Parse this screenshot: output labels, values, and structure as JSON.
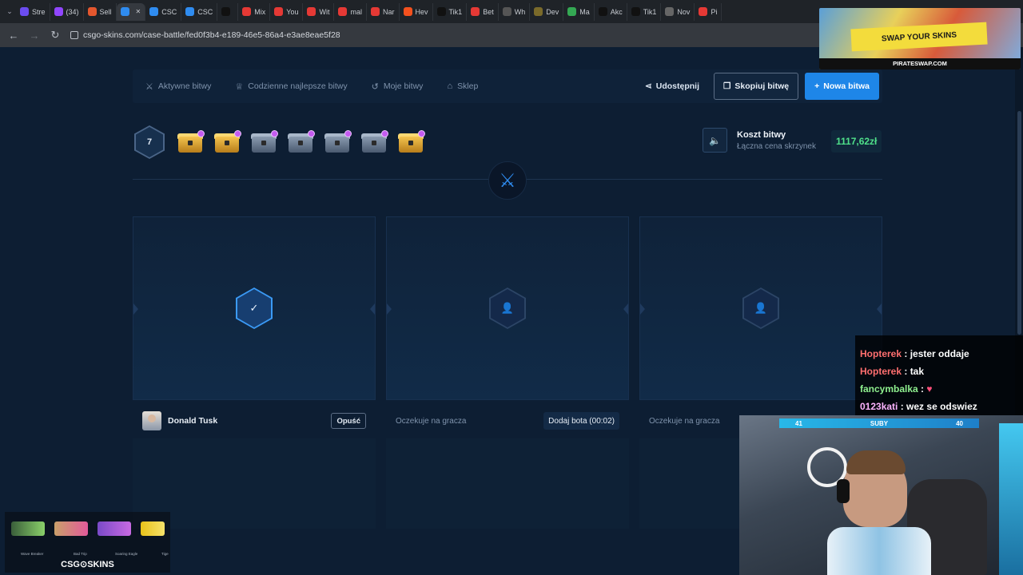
{
  "browser": {
    "tabs": [
      {
        "label": "Stre",
        "color": "#6b4cf0"
      },
      {
        "label": "(34)",
        "color": "#9146ff"
      },
      {
        "label": "Sell",
        "color": "#e4572e"
      },
      {
        "label": "",
        "color": "#2f8cf0",
        "active": true
      },
      {
        "label": "CSC",
        "color": "#2f8cf0"
      },
      {
        "label": "CSC",
        "color": "#2f8cf0"
      },
      {
        "label": "",
        "color": "#111111"
      },
      {
        "label": "Mix",
        "color": "#e53935"
      },
      {
        "label": "You",
        "color": "#e53935"
      },
      {
        "label": "Wit",
        "color": "#e53935"
      },
      {
        "label": "mal",
        "color": "#e53935"
      },
      {
        "label": "Nar",
        "color": "#e53935"
      },
      {
        "label": "Hev",
        "color": "#f4511e"
      },
      {
        "label": "Tik1",
        "color": "#111111"
      },
      {
        "label": "Bet",
        "color": "#e53935"
      },
      {
        "label": "Wh",
        "color": "#555555"
      },
      {
        "label": "Dev",
        "color": "#7a6a2a"
      },
      {
        "label": "Ma",
        "color": "#34a853"
      },
      {
        "label": "Akc",
        "color": "#111111"
      },
      {
        "label": "Tik1",
        "color": "#111111"
      },
      {
        "label": "Nov",
        "color": "#666666"
      },
      {
        "label": "Pi",
        "color": "#e53935"
      }
    ],
    "url": "csgo-skins.com/case-battle/fed0f3b4-e189-46e5-86a4-e3ae8eae5f28"
  },
  "nav": {
    "items": [
      {
        "label": "Aktywne bitwy",
        "icon": "swords-icon"
      },
      {
        "label": "Codzienne najlepsze bitwy",
        "icon": "trophy-icon"
      },
      {
        "label": "Moje bitwy",
        "icon": "history-icon"
      },
      {
        "label": "Sklep",
        "icon": "basket-icon"
      }
    ],
    "share_label": "Udostępnij",
    "copy_label": "Skopiuj bitwę",
    "new_label": "Nowa bitwa"
  },
  "battle": {
    "rounds": "7",
    "cases": [
      "gold",
      "gold",
      "steel",
      "steel",
      "steel",
      "steel",
      "gold"
    ],
    "cost_title": "Koszt bitwy",
    "cost_subtitle": "Łączna cena skrzynek",
    "cost_value": "1117,62zł",
    "accent": "#2f8cf0",
    "price_color": "#4fe08a"
  },
  "players": [
    {
      "name": "Donald Tusk",
      "action": "Opuść",
      "status": "ready"
    },
    {
      "waiting": "Oczekuje na gracza",
      "action": "Dodaj bota (00:02)"
    },
    {
      "waiting": "Oczekuje na gracza"
    }
  ],
  "overlay": {
    "ad_text": "SWAP YOUR SKINS",
    "ad_footer": "PIRATESWAP.COM",
    "chat": [
      {
        "user": "Hopterek",
        "msg": "jester oddaje",
        "color": "red"
      },
      {
        "user": "Hopterek",
        "msg": "tak",
        "color": "red"
      },
      {
        "user": "fancymbalka",
        "msg": "",
        "color": "green"
      },
      {
        "user": "0123kati",
        "msg": "wez se odswiez",
        "color": "pink"
      }
    ],
    "sub_left": "41",
    "sub_label": "SUBY",
    "sub_right": "40",
    "widget_guns": [
      "Wave Breaker",
      "Bad Trip",
      "Soaring Eagle",
      "Tige"
    ],
    "widget_brand": "CSG⊙SKINS"
  }
}
